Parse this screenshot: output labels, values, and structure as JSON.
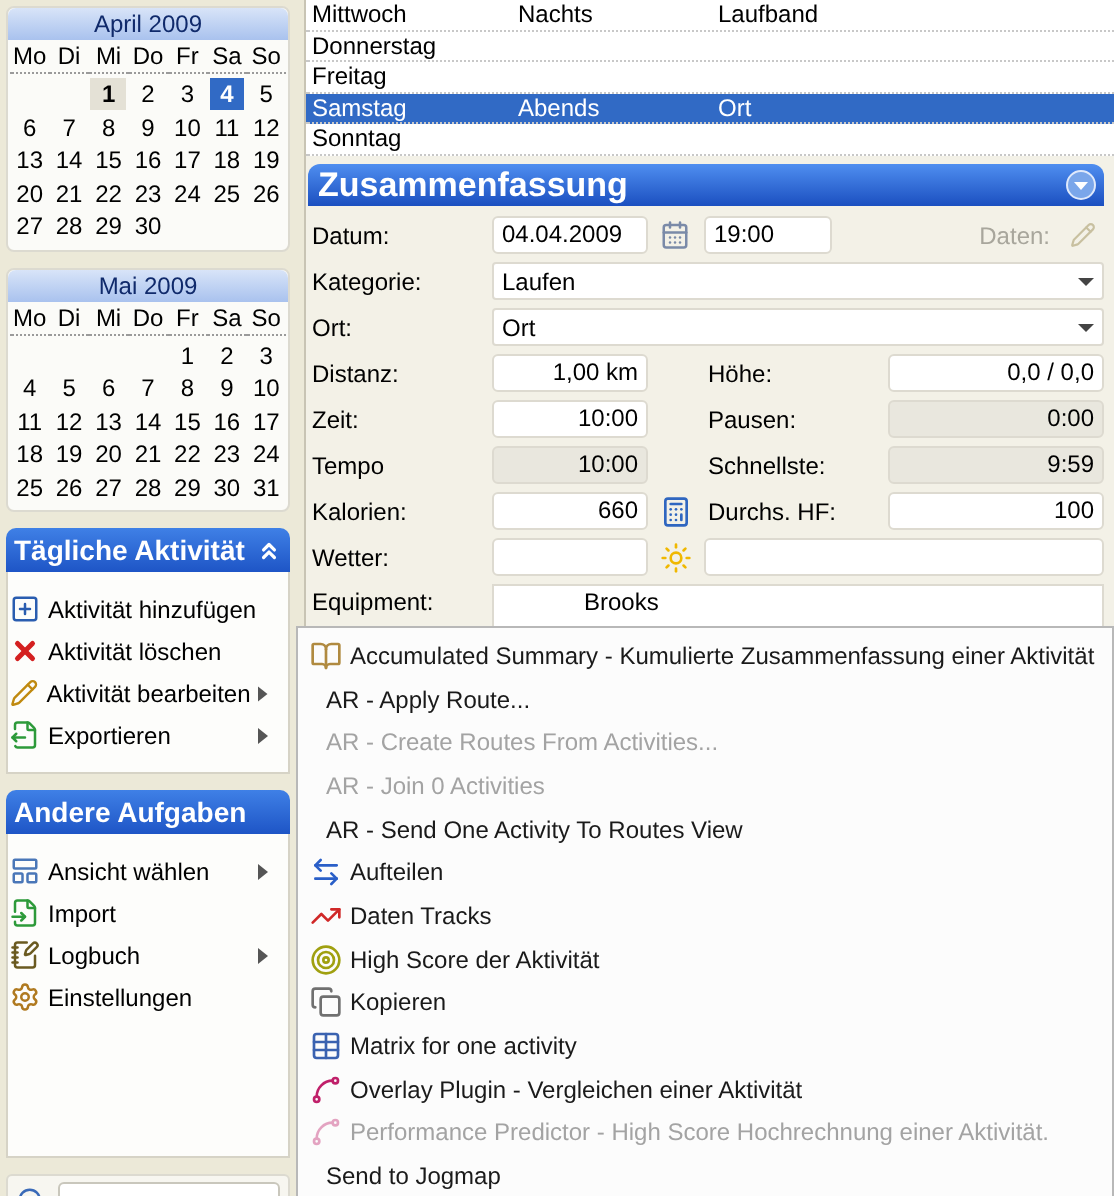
{
  "calendars": [
    {
      "title": "April 2009",
      "weekdays": [
        "Mo",
        "Di",
        "Mi",
        "Do",
        "Fr",
        "Sa",
        "So"
      ],
      "weeks": [
        [
          {
            "kind": "blank"
          },
          {
            "kind": "blank"
          },
          {
            "kind": "day",
            "day": "1",
            "today": true,
            "selected": false
          },
          {
            "kind": "day",
            "day": "2",
            "today": false,
            "selected": false
          },
          {
            "kind": "day",
            "day": "3",
            "today": false,
            "selected": false
          },
          {
            "kind": "day",
            "day": "4",
            "today": false,
            "selected": true
          },
          {
            "kind": "day",
            "day": "5",
            "today": false,
            "selected": false
          }
        ],
        [
          {
            "kind": "day",
            "day": "6",
            "today": false,
            "selected": false
          },
          {
            "kind": "day",
            "day": "7",
            "today": false,
            "selected": false
          },
          {
            "kind": "day",
            "day": "8",
            "today": false,
            "selected": false
          },
          {
            "kind": "day",
            "day": "9",
            "today": false,
            "selected": false
          },
          {
            "kind": "day",
            "day": "10",
            "today": false,
            "selected": false
          },
          {
            "kind": "day",
            "day": "11",
            "today": false,
            "selected": false
          },
          {
            "kind": "day",
            "day": "12",
            "today": false,
            "selected": false
          }
        ],
        [
          {
            "kind": "day",
            "day": "13",
            "today": false,
            "selected": false
          },
          {
            "kind": "day",
            "day": "14",
            "today": false,
            "selected": false
          },
          {
            "kind": "day",
            "day": "15",
            "today": false,
            "selected": false
          },
          {
            "kind": "day",
            "day": "16",
            "today": false,
            "selected": false
          },
          {
            "kind": "day",
            "day": "17",
            "today": false,
            "selected": false
          },
          {
            "kind": "day",
            "day": "18",
            "today": false,
            "selected": false
          },
          {
            "kind": "day",
            "day": "19",
            "today": false,
            "selected": false
          }
        ],
        [
          {
            "kind": "day",
            "day": "20",
            "today": false,
            "selected": false
          },
          {
            "kind": "day",
            "day": "21",
            "today": false,
            "selected": false
          },
          {
            "kind": "day",
            "day": "22",
            "today": false,
            "selected": false
          },
          {
            "kind": "day",
            "day": "23",
            "today": false,
            "selected": false
          },
          {
            "kind": "day",
            "day": "24",
            "today": false,
            "selected": false
          },
          {
            "kind": "day",
            "day": "25",
            "today": false,
            "selected": false
          },
          {
            "kind": "day",
            "day": "26",
            "today": false,
            "selected": false
          }
        ],
        [
          {
            "kind": "day",
            "day": "27",
            "today": false,
            "selected": false
          },
          {
            "kind": "day",
            "day": "28",
            "today": false,
            "selected": false
          },
          {
            "kind": "day",
            "day": "29",
            "today": false,
            "selected": false
          },
          {
            "kind": "day",
            "day": "30",
            "today": false,
            "selected": false
          }
        ]
      ]
    },
    {
      "title": "Mai 2009",
      "weekdays": [
        "Mo",
        "Di",
        "Mi",
        "Do",
        "Fr",
        "Sa",
        "So"
      ],
      "weeks": [
        [
          {
            "kind": "blank"
          },
          {
            "kind": "blank"
          },
          {
            "kind": "blank"
          },
          {
            "kind": "blank"
          },
          {
            "kind": "day",
            "day": "1",
            "today": false,
            "selected": false
          },
          {
            "kind": "day",
            "day": "2",
            "today": false,
            "selected": false
          },
          {
            "kind": "day",
            "day": "3",
            "today": false,
            "selected": false
          }
        ],
        [
          {
            "kind": "day",
            "day": "4",
            "today": false,
            "selected": false
          },
          {
            "kind": "day",
            "day": "5",
            "today": false,
            "selected": false
          },
          {
            "kind": "day",
            "day": "6",
            "today": false,
            "selected": false
          },
          {
            "kind": "day",
            "day": "7",
            "today": false,
            "selected": false
          },
          {
            "kind": "day",
            "day": "8",
            "today": false,
            "selected": false
          },
          {
            "kind": "day",
            "day": "9",
            "today": false,
            "selected": false
          },
          {
            "kind": "day",
            "day": "10",
            "today": false,
            "selected": false
          }
        ],
        [
          {
            "kind": "day",
            "day": "11",
            "today": false,
            "selected": false
          },
          {
            "kind": "day",
            "day": "12",
            "today": false,
            "selected": false
          },
          {
            "kind": "day",
            "day": "13",
            "today": false,
            "selected": false
          },
          {
            "kind": "day",
            "day": "14",
            "today": false,
            "selected": false
          },
          {
            "kind": "day",
            "day": "15",
            "today": false,
            "selected": false
          },
          {
            "kind": "day",
            "day": "16",
            "today": false,
            "selected": false
          },
          {
            "kind": "day",
            "day": "17",
            "today": false,
            "selected": false
          }
        ],
        [
          {
            "kind": "day",
            "day": "18",
            "today": false,
            "selected": false
          },
          {
            "kind": "day",
            "day": "19",
            "today": false,
            "selected": false
          },
          {
            "kind": "day",
            "day": "20",
            "today": false,
            "selected": false
          },
          {
            "kind": "day",
            "day": "21",
            "today": false,
            "selected": false
          },
          {
            "kind": "day",
            "day": "22",
            "today": false,
            "selected": false
          },
          {
            "kind": "day",
            "day": "23",
            "today": false,
            "selected": false
          },
          {
            "kind": "day",
            "day": "24",
            "today": false,
            "selected": false
          }
        ],
        [
          {
            "kind": "day",
            "day": "25",
            "today": false,
            "selected": false
          },
          {
            "kind": "day",
            "day": "26",
            "today": false,
            "selected": false
          },
          {
            "kind": "day",
            "day": "27",
            "today": false,
            "selected": false
          },
          {
            "kind": "day",
            "day": "28",
            "today": false,
            "selected": false
          },
          {
            "kind": "day",
            "day": "29",
            "today": false,
            "selected": false
          },
          {
            "kind": "day",
            "day": "30",
            "today": false,
            "selected": false
          },
          {
            "kind": "day",
            "day": "31",
            "today": false,
            "selected": false
          }
        ]
      ]
    }
  ],
  "task_panes": [
    {
      "title": "Tägliche Aktivität",
      "expanded": true,
      "items": [
        {
          "label": "Aktivität hinzufügen",
          "submenu": false
        },
        {
          "label": "Aktivität löschen",
          "submenu": false
        },
        {
          "label": "Aktivität bearbeiten",
          "submenu": true
        },
        {
          "label": "Exportieren",
          "submenu": true
        }
      ]
    },
    {
      "title": "Andere Aufgaben",
      "items": [
        {
          "label": "Ansicht wählen",
          "submenu": true
        },
        {
          "label": "Import",
          "submenu": false
        },
        {
          "label": "Logbuch",
          "submenu": true
        },
        {
          "label": "Einstellungen",
          "submenu": false
        }
      ]
    }
  ],
  "table": {
    "rows": [
      {
        "cells": [
          "Mittwoch",
          "Nachts",
          "Laufband"
        ],
        "selected": false
      },
      {
        "cells": [
          "Donnerstag"
        ],
        "selected": false
      },
      {
        "cells": [
          "Freitag"
        ],
        "selected": false
      },
      {
        "cells": [
          "Samstag",
          "Abends",
          "Ort"
        ],
        "selected": true
      },
      {
        "cells": [
          "Sonntag"
        ],
        "selected": false
      }
    ]
  },
  "summary": {
    "title": "Zusammenfassung",
    "rows": [
      {
        "kind": "date",
        "label": "Datum:",
        "date": "04.04.2009",
        "time": "19:00",
        "data_label": "Daten:"
      },
      {
        "kind": "combo",
        "label": "Kategorie:",
        "value": "Laufen"
      },
      {
        "kind": "combo",
        "label": "Ort:",
        "value": "Ort"
      },
      {
        "kind": "pair",
        "left": {
          "label": "Distanz:",
          "value": "1,00 km",
          "readonly": false
        },
        "right": {
          "label": "Höhe:",
          "value": "0,0 / 0,0",
          "readonly": false
        }
      },
      {
        "kind": "pair",
        "left": {
          "label": "Zeit:",
          "value": "10:00",
          "readonly": false
        },
        "right": {
          "label": "Pausen:",
          "value": "0:00",
          "readonly": true
        }
      },
      {
        "kind": "pair",
        "left": {
          "label": "Tempo",
          "value": "10:00",
          "readonly": true
        },
        "right": {
          "label": "Schnellste:",
          "value": "9:59",
          "readonly": true
        }
      },
      {
        "kind": "calc_pair",
        "left": {
          "label": "Kalorien:",
          "value": "660",
          "readonly": false
        },
        "right": {
          "label": "Durchs. HF:",
          "value": "100",
          "readonly": false
        }
      },
      {
        "kind": "weather",
        "label": "Wetter:"
      },
      {
        "kind": "list",
        "label": "Equipment:",
        "items": [
          "Brooks"
        ]
      }
    ]
  },
  "context_menu": [
    {
      "label": "Accumulated Summary - Kumulierte Zusammenfassung einer Aktivität",
      "disabled": false
    },
    {
      "label": "AR - Apply Route...",
      "disabled": false
    },
    {
      "label": "AR - Create Routes From Activities...",
      "disabled": true
    },
    {
      "label": "AR - Join  0 Activities",
      "disabled": true
    },
    {
      "label": "AR - Send One Activity To Routes View",
      "disabled": false
    },
    {
      "label": "Aufteilen",
      "disabled": false
    },
    {
      "label": "Daten Tracks",
      "disabled": false
    },
    {
      "label": "High Score der Aktivität",
      "disabled": false
    },
    {
      "label": "Kopieren",
      "disabled": false
    },
    {
      "label": "Matrix for one activity",
      "disabled": false
    },
    {
      "label": "Overlay Plugin - Vergleichen einer Aktivität",
      "disabled": false
    },
    {
      "label": "Performance Predictor - High Score Hochrechnung einer Aktivität.",
      "disabled": true
    },
    {
      "label": "Send to Jogmap",
      "disabled": false
    }
  ]
}
